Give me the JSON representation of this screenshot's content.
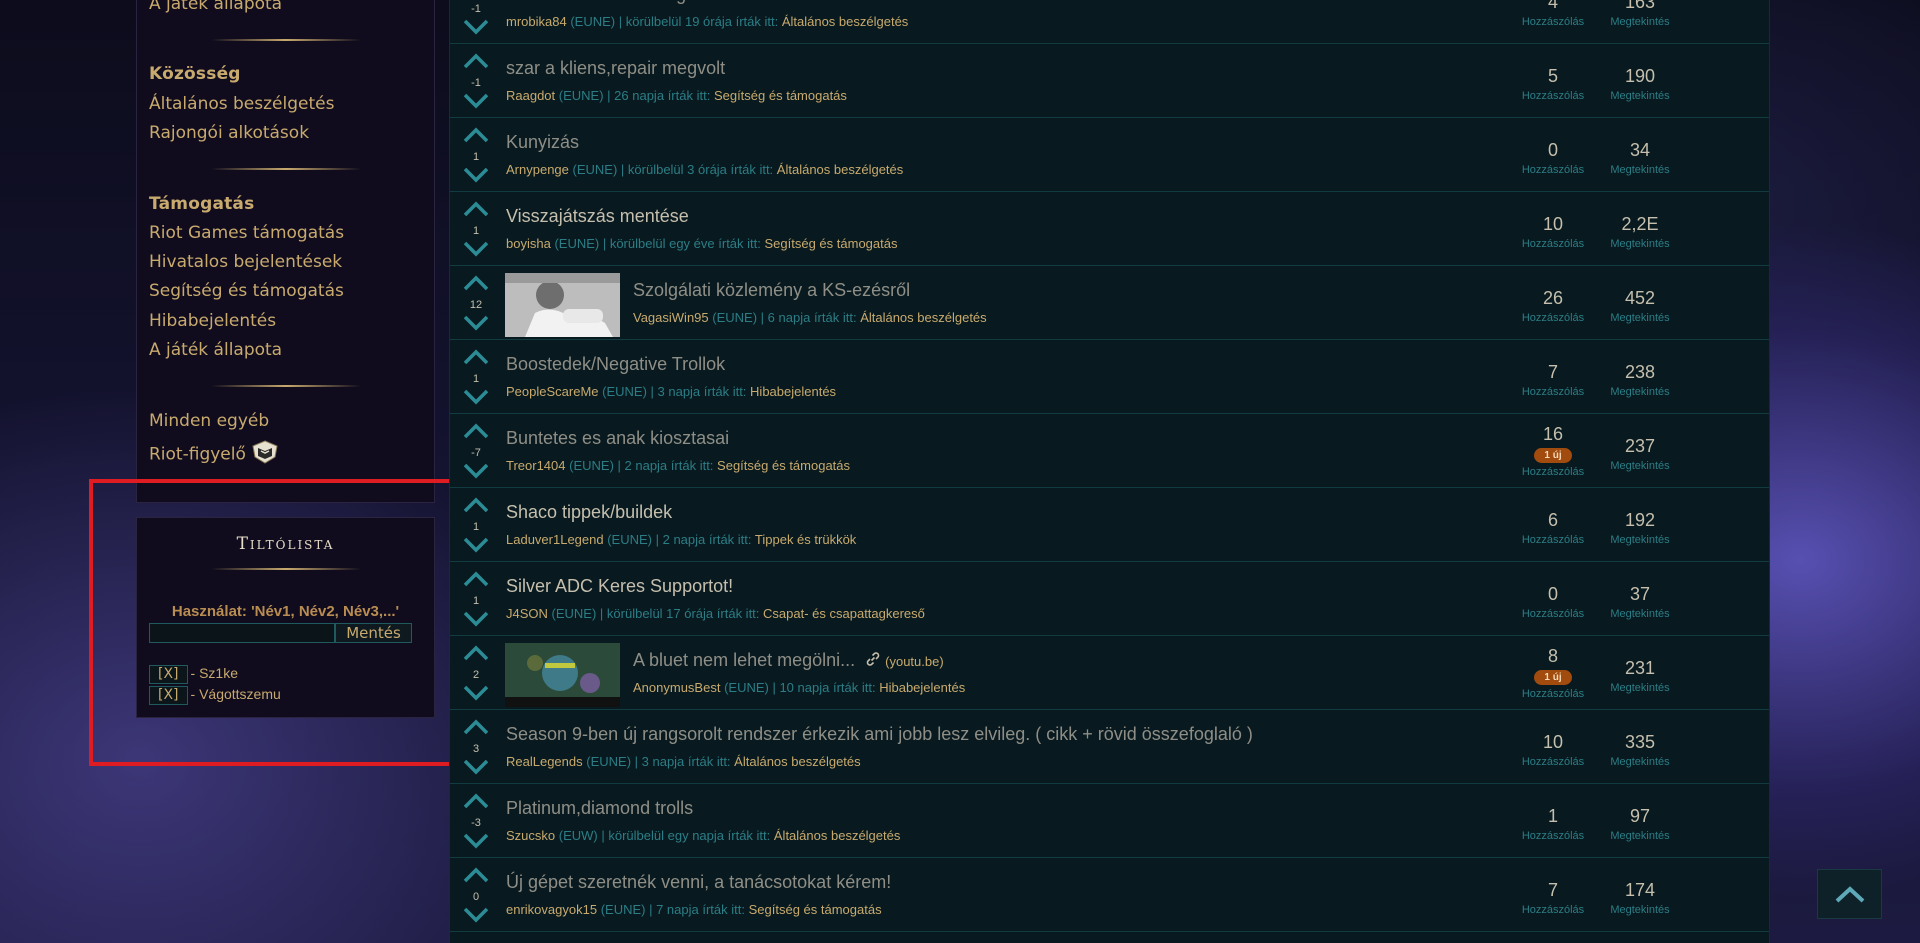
{
  "nav": {
    "top_link": "A játék állapota",
    "community_heading": "Közösség",
    "community_items": [
      "Általános beszélgetés",
      "Rajongói alkotások"
    ],
    "support_heading": "Támogatás",
    "support_items": [
      "Riot Games támogatás",
      "Hivatalos bejelentések",
      "Segítség és támogatás",
      "Hibabejelentés",
      "A játék állapota"
    ],
    "other_items": [
      "Minden egyéb",
      "Riot-figyelő"
    ]
  },
  "ignore_list": {
    "title": "Tiltólista",
    "usage": "Használat: 'Név1, Név2, Név3,...'",
    "input_value": "",
    "save_label": "Mentés",
    "remove_label": "[X]",
    "entries": [
      "- Sz1ke",
      "- Vágottszemu"
    ]
  },
  "labels": {
    "replies": "Hozzászólás",
    "views": "Megtekintés",
    "new": "1 új",
    "written_in": "írták itt:"
  },
  "threads": [
    {
      "score": "-1",
      "title": "Örök bann a közösségoknek....",
      "author": "mrobika84",
      "region": "(EUNE)",
      "time": "körülbelül 19 órája",
      "category": "Általános beszélgetés",
      "replies": "4",
      "views": "163",
      "read": true
    },
    {
      "score": "-1",
      "title": "szar a kliens,repair megvolt",
      "author": "Raagdot",
      "region": "(EUNE)",
      "time": "26 napja",
      "category": "Segítség és támogatás",
      "replies": "5",
      "views": "190",
      "read": true
    },
    {
      "score": "1",
      "title": "Kunyizás",
      "author": "Arnypenge",
      "region": "(EUNE)",
      "time": "körülbelül 3 órája",
      "category": "Általános beszélgetés",
      "replies": "0",
      "views": "34",
      "read": true
    },
    {
      "score": "1",
      "title": "Visszajátszás mentése",
      "author": "boyisha",
      "region": "(EUNE)",
      "time": "körülbelül egy éve",
      "category": "Segítség és támogatás",
      "replies": "10",
      "views": "2,2E",
      "read": false
    },
    {
      "score": "12",
      "title": "Szolgálati közlemény a KS-ezésről",
      "author": "VagasiWin95",
      "region": "(EUNE)",
      "time": "6 napja",
      "category": "Általános beszélgetés",
      "replies": "26",
      "views": "452",
      "read": true,
      "thumb": "photo"
    },
    {
      "score": "1",
      "title": "Boostedek/Negative Trollok",
      "author": "PeopleScareMe",
      "region": "(EUNE)",
      "time": "3 napja",
      "category": "Hibabejelentés",
      "replies": "7",
      "views": "238",
      "read": true
    },
    {
      "score": "-7",
      "title": "Buntetes es anak kiosztasai",
      "author": "Treor1404",
      "region": "(EUNE)",
      "time": "2 napja",
      "category": "Segítség és támogatás",
      "replies": "16",
      "views": "237",
      "read": true,
      "new": true
    },
    {
      "score": "1",
      "title": "Shaco tippek/buildek",
      "author": "Laduver1Legend",
      "region": "(EUNE)",
      "time": "2 napja",
      "category": "Tippek és trükkök",
      "replies": "6",
      "views": "192",
      "read": false
    },
    {
      "score": "1",
      "title": "Silver ADC Keres Supportot!",
      "author": "J4SON",
      "region": "(EUNE)",
      "time": "körülbelül 17 órája",
      "category": "Csapat- és csapattagkereső",
      "replies": "0",
      "views": "37",
      "read": false
    },
    {
      "score": "2",
      "title": "A bluet nem lehet megölni...",
      "domain": "(youtu.be)",
      "author": "AnonymusBest",
      "region": "(EUNE)",
      "time": "10 napja",
      "category": "Hibabejelentés",
      "replies": "8",
      "views": "231",
      "read": true,
      "new": true,
      "thumb": "game"
    },
    {
      "score": "3",
      "title": "Season 9-ben új rangsorolt rendszer érkezik ami jobb lesz elvileg. ( cikk + rövid összefoglaló )",
      "author": "RealLegends",
      "region": "(EUNE)",
      "time": "3 napja",
      "category": "Általános beszélgetés",
      "replies": "10",
      "views": "335",
      "read": true
    },
    {
      "score": "-3",
      "title": "Platinum,diamond trolls",
      "author": "Szucsko",
      "region": "(EUW)",
      "time": "körülbelül egy napja",
      "category": "Általános beszélgetés",
      "replies": "1",
      "views": "97",
      "read": true
    },
    {
      "score": "0",
      "title": "Új gépet szeretnék venni, a tanácsotokat kérem!",
      "author": "enrikovagyok15",
      "region": "(EUNE)",
      "time": "7 napja",
      "category": "Segítség és támogatás",
      "replies": "7",
      "views": "174",
      "read": true
    }
  ]
}
